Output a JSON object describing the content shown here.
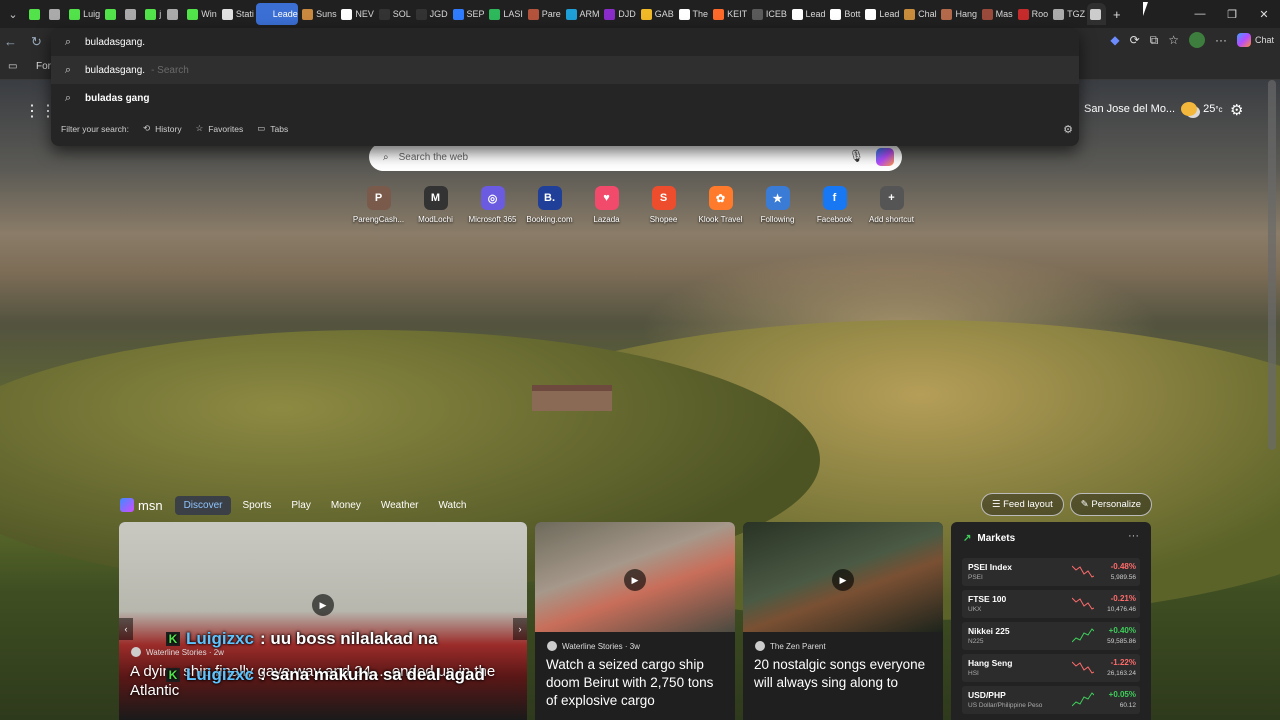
{
  "tabs": [
    {
      "label": "",
      "color": "#52e24a"
    },
    {
      "label": "",
      "color": "#aaaaaa"
    },
    {
      "label": "Luig",
      "color": "#52e24a"
    },
    {
      "label": "",
      "color": "#52e24a"
    },
    {
      "label": "",
      "color": "#aaaaaa"
    },
    {
      "label": "j",
      "color": "#52e24a"
    },
    {
      "label": "",
      "color": "#aaaaaa"
    },
    {
      "label": "Win",
      "color": "#52e24a"
    },
    {
      "label": "Stati",
      "color": "#e1e1e1"
    },
    {
      "label": "Leade",
      "color": "#3b6fd4"
    },
    {
      "label": "Suns",
      "color": "#c9883f"
    },
    {
      "label": "NEV",
      "color": "#ffffff"
    },
    {
      "label": "SOL",
      "color": "#333333"
    },
    {
      "label": "JGD",
      "color": "#333333"
    },
    {
      "label": "SEP",
      "color": "#2f7cff"
    },
    {
      "label": "LASI",
      "color": "#2eb85c"
    },
    {
      "label": "Pare",
      "color": "#b4533c"
    },
    {
      "label": "ARM",
      "color": "#1e9fd8"
    },
    {
      "label": "DJD",
      "color": "#8a2cc9"
    },
    {
      "label": "GAB",
      "color": "#f0b928"
    },
    {
      "label": "The",
      "color": "#ffffff"
    },
    {
      "label": "KEIT",
      "color": "#ff6a2a"
    },
    {
      "label": "ICEB",
      "color": "#5a5a5a"
    },
    {
      "label": "Lead",
      "color": "#ffffff"
    },
    {
      "label": "Bott",
      "color": "#ffffff"
    },
    {
      "label": "Lead",
      "color": "#ffffff"
    },
    {
      "label": "Chal",
      "color": "#c98c3c"
    },
    {
      "label": "Hang",
      "color": "#b46a4a"
    },
    {
      "label": "Mas",
      "color": "#9a4a3a"
    },
    {
      "label": "Roo",
      "color": "#c62b2b"
    },
    {
      "label": "TGZ",
      "color": "#aaaaaa"
    },
    {
      "label": "",
      "color": "#cccccc"
    }
  ],
  "toolbar": {
    "chat_label": "Chat"
  },
  "favorites": {
    "first_label": "For"
  },
  "omnibox": {
    "input": "buladasgang.",
    "suggestions": [
      {
        "text": "buladasgang.",
        "suffix": "- Search"
      },
      {
        "text": "buladas gang",
        "suffix": ""
      }
    ],
    "filter_label": "Filter your search:",
    "filters": [
      "History",
      "Favorites",
      "Tabs"
    ]
  },
  "ntp": {
    "weather": {
      "location": "San Jose del Mo...",
      "temp": "25",
      "unit": "°c"
    },
    "search_placeholder": "Search the web",
    "shortcuts": [
      {
        "label": "ParengCash...",
        "glyph": "P",
        "color": "#7a5a4a"
      },
      {
        "label": "ModLochi",
        "glyph": "M",
        "color": "#333333"
      },
      {
        "label": "Microsoft 365",
        "glyph": "◎",
        "color": "#6a5be0"
      },
      {
        "label": "Booking.com",
        "glyph": "B.",
        "color": "#1f3f99"
      },
      {
        "label": "Lazada",
        "glyph": "♥",
        "color": "#f14a6a"
      },
      {
        "label": "Shopee",
        "glyph": "S",
        "color": "#ee4d2d"
      },
      {
        "label": "Klook Travel",
        "glyph": "✿",
        "color": "#ff7a2a"
      },
      {
        "label": "Following",
        "glyph": "★",
        "color": "#3a7bd5"
      },
      {
        "label": "Facebook",
        "glyph": "f",
        "color": "#1877f2"
      },
      {
        "label": "Add shortcut",
        "glyph": "+",
        "color": "#555555"
      }
    ]
  },
  "msn": {
    "brand": "msn",
    "tabs": [
      "Discover",
      "Sports",
      "Play",
      "Money",
      "Weather",
      "Watch"
    ],
    "feed_layout": "Feed layout",
    "personalize": "Personalize",
    "cards": [
      {
        "source": "Waterline Stories · 2w",
        "title": "A dying ship finally gave way and 24 ... ended up in the Atlantic"
      },
      {
        "source": "Waterline Stories · 3w",
        "title": "Watch a seized cargo ship doom Beirut with 2,750 tons of explosive cargo"
      },
      {
        "source": "The Zen Parent",
        "title": "20 nostalgic songs everyone will always sing along to"
      }
    ],
    "captions": [
      {
        "user": "Luigizxc",
        "text": ": uu boss nilalakad na"
      },
      {
        "user": "Luigizxc",
        "text": ": sana makuha sa deal agad"
      }
    ]
  },
  "markets": {
    "title": "Markets",
    "rows": [
      {
        "name": "PSEI Index",
        "sub": "PSEI",
        "pct": "-0.48%",
        "value": "5,989.56",
        "dir": "neg"
      },
      {
        "name": "FTSE 100",
        "sub": "UKX",
        "pct": "-0.21%",
        "value": "10,476.46",
        "dir": "neg"
      },
      {
        "name": "Nikkei 225",
        "sub": "N225",
        "pct": "+0.40%",
        "value": "59,585.86",
        "dir": "pos"
      },
      {
        "name": "Hang Seng",
        "sub": "HSI",
        "pct": "-1.22%",
        "value": "26,163.24",
        "dir": "neg"
      },
      {
        "name": "USD/PHP",
        "sub": "US Dollar/Philippine Peso",
        "pct": "+0.05%",
        "value": "60.12",
        "dir": "pos"
      }
    ]
  }
}
